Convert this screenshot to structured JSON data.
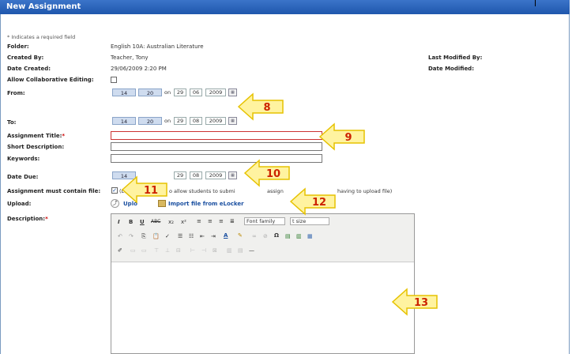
{
  "header": {
    "title": "New Assignment"
  },
  "required_note": "* Indicates a required field",
  "fields": {
    "folder_label": "Folder:",
    "folder_value": "English 10A: Australian Literature",
    "created_by_label": "Created By:",
    "created_by_value": "Teacher, Tony",
    "date_created_label": "Date Created:",
    "date_created_value": "29/06/2009 2:20 PM",
    "last_modified_label": "Last Modified By:",
    "date_modified_label": "Date Modified:",
    "collab_label": "Allow Collaborative Editing:",
    "from_label": "From:",
    "to_label": "To:",
    "title_label": "Assignment Title:",
    "short_desc_label": "Short Description:",
    "keywords_label": "Keywords:",
    "due_label": "Date Due:",
    "must_contain_label": "Assignment must contain file:",
    "upload_label": "Upload:",
    "description_label": "Description:"
  },
  "from": {
    "hour": "14",
    "minute": "20",
    "on": "on",
    "day": "29",
    "month": "06",
    "year": "2009"
  },
  "to": {
    "hour": "14",
    "minute": "20",
    "on": "on",
    "day": "29",
    "month": "08",
    "year": "2009"
  },
  "due": {
    "hour": "14",
    "day": "29",
    "month": "08",
    "year": "2009"
  },
  "must_contain_text_a": "(Le",
  "must_contain_text_b": "o allow students to submi",
  "must_contain_text_c": "assign",
  "must_contain_text_d": "having to upload file)",
  "upload": {
    "upload_text": "Uplo",
    "import_text": "Import file from eLocker"
  },
  "editor": {
    "font_family": "Font family",
    "font_size": "t size"
  },
  "callouts": [
    "8",
    "9",
    "10",
    "11",
    "12",
    "13"
  ],
  "colors": {
    "header": "#2563b8",
    "callout_fill": "#fff3a0",
    "callout_text": "#cc2200"
  }
}
